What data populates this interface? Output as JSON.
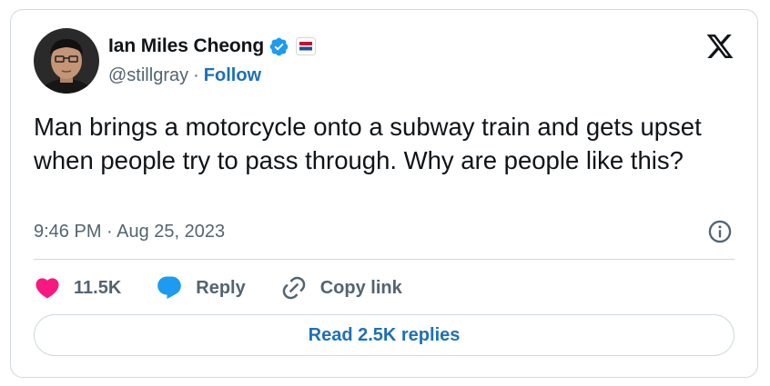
{
  "author": {
    "display_name": "Ian Miles Cheong",
    "handle": "@stillgray",
    "separator": "·",
    "follow_label": "Follow"
  },
  "tweet": {
    "text": "Man brings a motorcycle onto a subway train and gets upset when people try to pass through. Why are people like this?",
    "timestamp": "9:46 PM · Aug 25, 2023"
  },
  "actions": {
    "like_count": "11.5K",
    "reply_label": "Reply",
    "copy_link_label": "Copy link"
  },
  "replies_button": {
    "label": "Read 2.5K replies"
  },
  "icons": {
    "verified": "verified-badge-icon",
    "affiliate": "affiliate-badge-icon",
    "platform": "x-logo-icon",
    "info": "info-icon",
    "like": "heart-icon",
    "reply": "reply-bubble-icon",
    "copy_link": "link-icon"
  },
  "colors": {
    "link_blue": "#1d70b8",
    "verified_blue": "#1d9bf0",
    "like_pink": "#f91880",
    "text_primary": "#0f1419",
    "text_secondary": "#536471",
    "border": "#cfd9de"
  }
}
